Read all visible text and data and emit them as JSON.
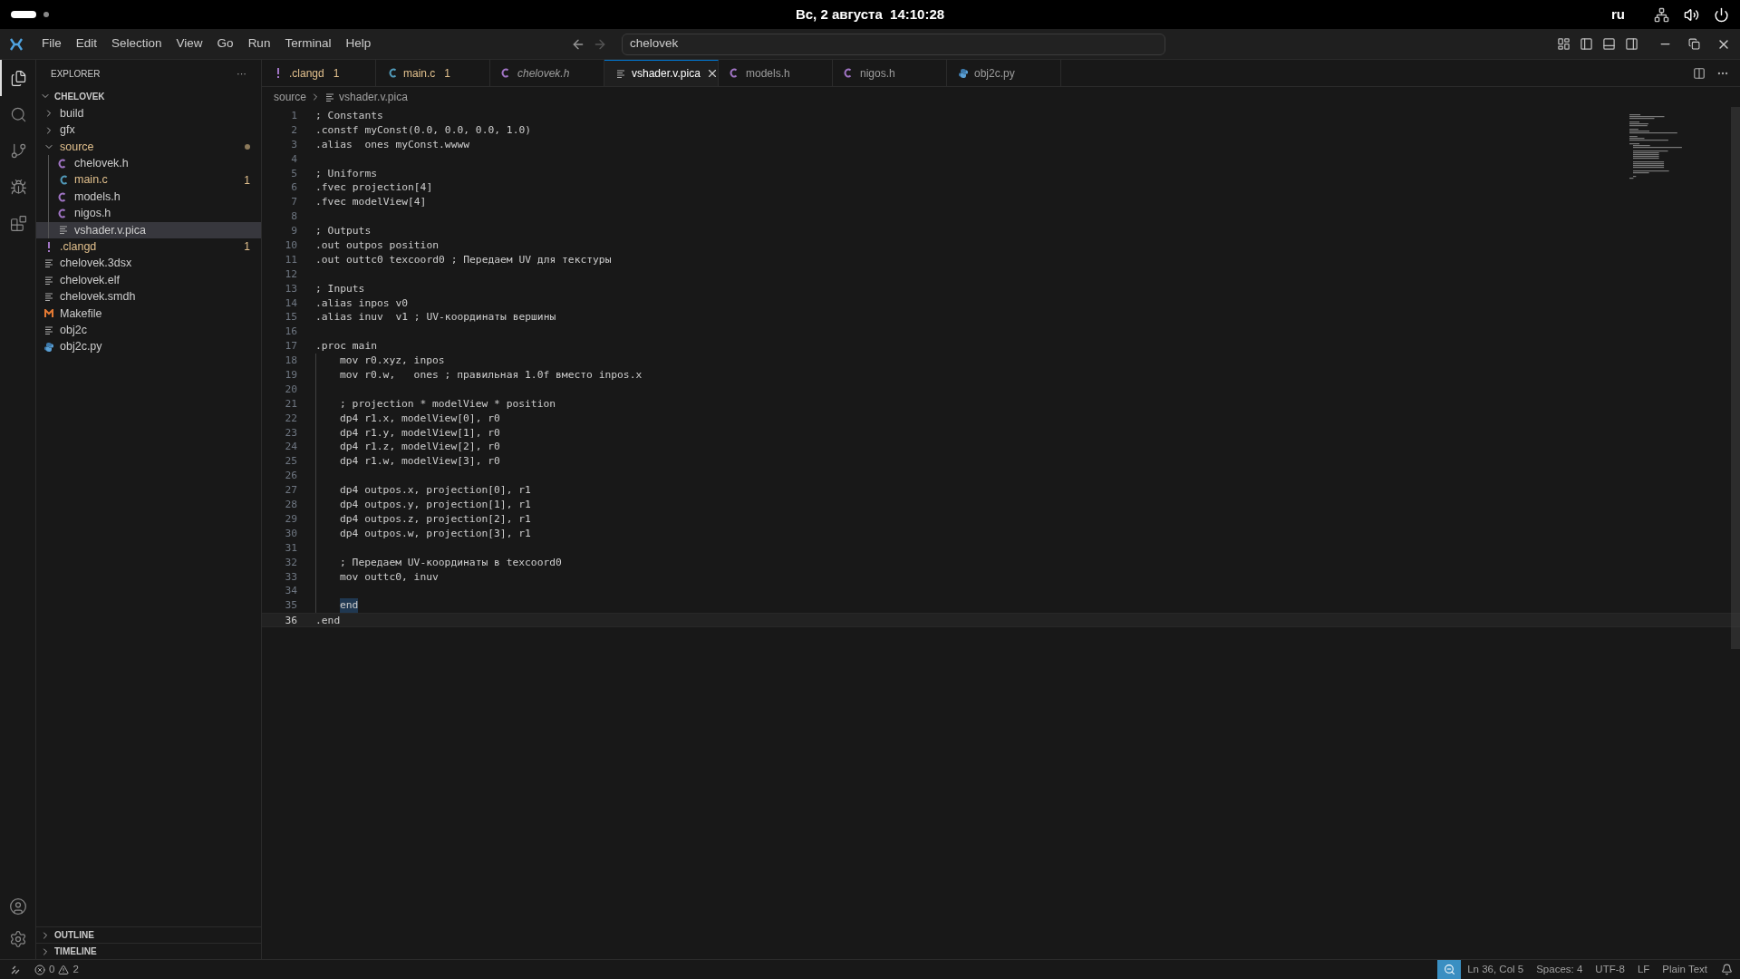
{
  "system_bar": {
    "clock": "Вс, 2 августа  14:10:28",
    "keyboard_layout": "ru"
  },
  "title_bar": {
    "menu": [
      "File",
      "Edit",
      "Selection",
      "View",
      "Go",
      "Run",
      "Terminal",
      "Help"
    ],
    "search": {
      "value": "chelovek"
    }
  },
  "activity_bar": [
    {
      "kind": "files",
      "selected": true
    },
    {
      "kind": "search",
      "selected": false
    },
    {
      "kind": "source-control",
      "selected": false
    },
    {
      "kind": "debug",
      "selected": false
    },
    {
      "kind": "extensions",
      "selected": false
    }
  ],
  "sidebar": {
    "title": "EXPLORER",
    "more": "···",
    "project": "CHELOVEK",
    "items": [
      {
        "label": "build",
        "kind": "folder",
        "expanded": false,
        "selected": false
      },
      {
        "label": "gfx",
        "kind": "folder",
        "expanded": false,
        "selected": false
      },
      {
        "label": "source",
        "kind": "folder",
        "expanded": true,
        "selected": false,
        "problem": true,
        "children": [
          {
            "label": "chelovek.h",
            "kind": "c-header",
            "selected": false
          },
          {
            "label": "main.c",
            "kind": "c-source",
            "selected": false,
            "problem": true,
            "badge": "1"
          },
          {
            "label": "models.h",
            "kind": "c-header",
            "selected": false
          },
          {
            "label": "nigos.h",
            "kind": "c-header",
            "selected": false
          },
          {
            "label": "vshader.v.pica",
            "kind": "text",
            "selected": true
          }
        ]
      },
      {
        "label": ".clangd",
        "kind": "config",
        "selected": false,
        "problem": true,
        "badge": "1"
      },
      {
        "label": "chelovek.3dsx",
        "kind": "text",
        "selected": false
      },
      {
        "label": "chelovek.elf",
        "kind": "text",
        "selected": false
      },
      {
        "label": "chelovek.smdh",
        "kind": "text",
        "selected": false
      },
      {
        "label": "Makefile",
        "kind": "makefile",
        "selected": false
      },
      {
        "label": "obj2c",
        "kind": "text",
        "selected": false
      },
      {
        "label": "obj2c.py",
        "kind": "python",
        "selected": false
      }
    ],
    "sections": [
      "OUTLINE",
      "TIMELINE"
    ]
  },
  "tabs": [
    {
      "label": ".clangd",
      "kind": "config",
      "badge": "1",
      "problem": true,
      "preview": false,
      "selected": false
    },
    {
      "label": "main.c",
      "kind": "c-source",
      "badge": "1",
      "problem": true,
      "preview": false,
      "selected": false
    },
    {
      "label": "chelovek.h",
      "kind": "c-header",
      "problem": false,
      "preview": true,
      "selected": false
    },
    {
      "label": "vshader.v.pica",
      "kind": "text",
      "problem": false,
      "preview": false,
      "selected": true
    },
    {
      "label": "models.h",
      "kind": "c-header",
      "problem": false,
      "preview": false,
      "selected": false
    },
    {
      "label": "nigos.h",
      "kind": "c-header",
      "problem": false,
      "preview": false,
      "selected": false
    },
    {
      "label": "obj2c.py",
      "kind": "python",
      "problem": false,
      "preview": false,
      "selected": false
    }
  ],
  "breadcrumb": [
    "source",
    "vshader.v.pica"
  ],
  "editor": {
    "lines": [
      {
        "number": "1",
        "text": "; Constants"
      },
      {
        "number": "2",
        "text": ".constf myConst(0.0, 0.0, 0.0, 1.0)"
      },
      {
        "number": "3",
        "text": ".alias  ones myConst.wwww"
      },
      {
        "number": "4"
      },
      {
        "number": "5",
        "text": "; Uniforms"
      },
      {
        "number": "6",
        "text": ".fvec projection[4]"
      },
      {
        "number": "7",
        "text": ".fvec modelView[4]"
      },
      {
        "number": "8"
      },
      {
        "number": "9",
        "text": "; Outputs"
      },
      {
        "number": "10",
        "text": ".out outpos position"
      },
      {
        "number": "11",
        "text": ".out outtc0 texcoord0 ; Передаем UV для текстуры"
      },
      {
        "number": "12"
      },
      {
        "number": "13",
        "text": "; Inputs"
      },
      {
        "number": "14",
        "text": ".alias inpos v0"
      },
      {
        "number": "15",
        "text": ".alias inuv  v1 ; UV-координаты вершины"
      },
      {
        "number": "16"
      },
      {
        "number": "17",
        "text": ".proc main"
      },
      {
        "number": "18",
        "indented": true,
        "text": "mov r0.xyz, inpos"
      },
      {
        "number": "19",
        "indented": true,
        "text": "mov r0.w,   ones ; правильная 1.0f вместо inpos.x"
      },
      {
        "number": "20",
        "indented": true
      },
      {
        "number": "21",
        "indented": true,
        "text": "; projection * modelView * position"
      },
      {
        "number": "22",
        "indented": true,
        "text": "dp4 r1.x, modelView[0], r0"
      },
      {
        "number": "23",
        "indented": true,
        "text": "dp4 r1.y, modelView[1], r0"
      },
      {
        "number": "24",
        "indented": true,
        "text": "dp4 r1.z, modelView[2], r0"
      },
      {
        "number": "25",
        "indented": true,
        "text": "dp4 r1.w, modelView[3], r0"
      },
      {
        "number": "26",
        "indented": true
      },
      {
        "number": "27",
        "indented": true,
        "text": "dp4 outpos.x, projection[0], r1"
      },
      {
        "number": "28",
        "indented": true,
        "text": "dp4 outpos.y, projection[1], r1"
      },
      {
        "number": "29",
        "indented": true,
        "text": "dp4 outpos.z, projection[2], r1"
      },
      {
        "number": "30",
        "indented": true,
        "text": "dp4 outpos.w, projection[3], r1"
      },
      {
        "number": "31",
        "indented": true
      },
      {
        "number": "32",
        "indented": true,
        "text": "; Передаем UV-координаты в texcoord0"
      },
      {
        "number": "33",
        "indented": true,
        "text": "mov outtc0, inuv"
      },
      {
        "number": "34",
        "indented": true
      },
      {
        "number": "35",
        "indented": true,
        "text": "end",
        "highlighted": true
      },
      {
        "number": "36",
        "text": ".end",
        "current": true
      }
    ]
  },
  "status_bar": {
    "errors": "0",
    "warnings": "2",
    "items": [
      "Ln 36, Col 5",
      "Spaces: 4",
      "UTF-8",
      "LF",
      "Plain Text"
    ]
  }
}
